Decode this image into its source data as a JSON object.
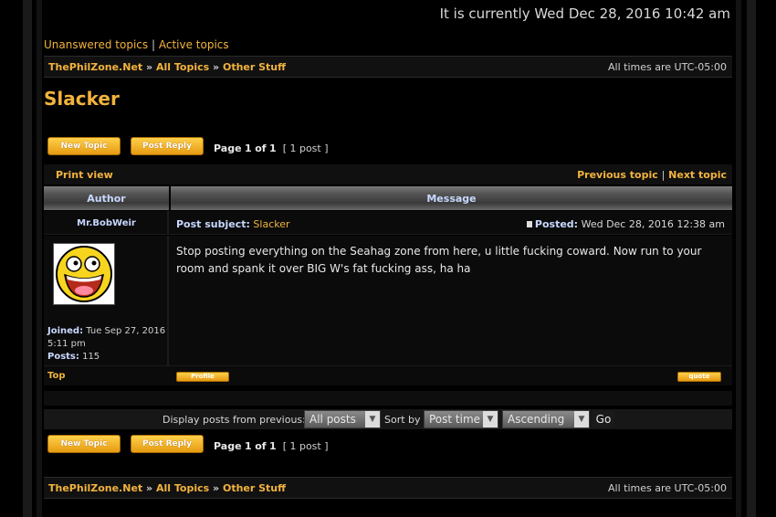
{
  "header": {
    "current_time": "It is currently Wed Dec 28, 2016 10:42 am",
    "unanswered": "Unanswered topics",
    "separator": "|",
    "active": "Active topics"
  },
  "breadcrumb": {
    "items": [
      "ThePhilZone.Net",
      "All Topics",
      "Other Stuff"
    ],
    "arrow": "»",
    "timezone": "All times are UTC-05:00"
  },
  "topic": {
    "title": "Slacker"
  },
  "buttons": {
    "new_topic": "New Topic",
    "post_reply": "Post Reply"
  },
  "pagination": {
    "page_label": "Page",
    "current": "1",
    "of_label": "of",
    "total": "1",
    "post_count": "[ 1 post ]"
  },
  "printbar": {
    "print_view": "Print view",
    "previous": "Previous topic",
    "separator": "|",
    "next": "Next topic"
  },
  "table_headers": {
    "author": "Author",
    "message": "Message"
  },
  "post": {
    "author": "Mr.BobWeir",
    "subject_label": "Post subject:",
    "subject": "Slacker",
    "posted_label": "Posted:",
    "posted_date": "Wed Dec 28, 2016 12:38 am",
    "body": "Stop posting everything on the Seahag zone from here, u little fucking coward. Now run to your room and spank it over BIG W's fat fucking ass, ha ha",
    "joined_label": "Joined:",
    "joined_date": "Tue Sep 27, 2016 5:11 pm",
    "posts_label": "Posts:",
    "posts_count": "115",
    "top_link": "Top",
    "profile_btn": "Profile",
    "quote_btn": "quote"
  },
  "sort": {
    "display_label": "Display posts from previous:",
    "display_value": "All posts",
    "sort_label": "Sort by",
    "sort_value": "Post time",
    "order_value": "Ascending",
    "go": "Go"
  },
  "colors": {
    "accent": "#f2b33d",
    "username": "#c8d8ff",
    "background": "#000000"
  }
}
